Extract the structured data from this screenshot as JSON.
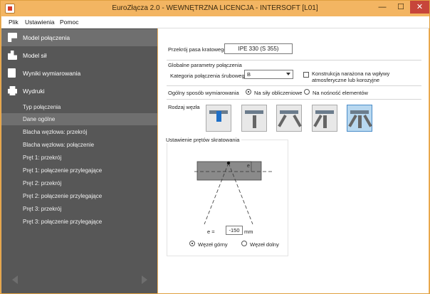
{
  "window": {
    "title": "EuroZłącza 2.0 - WEWNĘTRZNA LICENCJA - INTERSOFT [L01]",
    "min": "—",
    "max": "☐",
    "close": "✕"
  },
  "menu": [
    "Plik",
    "Ustawienia",
    "Pomoc"
  ],
  "sidebar": {
    "top_items": [
      {
        "label": "Model połączenia",
        "icon": "flag-icon",
        "active": true
      },
      {
        "label": "Model sił",
        "icon": "beam-icon",
        "active": false
      },
      {
        "label": "Wyniki wymiarowania",
        "icon": "results-icon",
        "active": false
      },
      {
        "label": "Wydruki",
        "icon": "printer-icon",
        "active": false
      }
    ],
    "sub_items": [
      {
        "label": "Typ połączenia",
        "active": false
      },
      {
        "label": "Dane ogólne",
        "active": true
      },
      {
        "label": "Blacha węzłowa: przekrój",
        "active": false
      },
      {
        "label": "Blacha węzłowa: połączenie",
        "active": false
      },
      {
        "label": "Pręt 1: przekrój",
        "active": false
      },
      {
        "label": "Pręt 1: połączenie przylegające",
        "active": false
      },
      {
        "label": "Pręt 2: przekrój",
        "active": false
      },
      {
        "label": "Pręt 2: połączenie przylegające",
        "active": false
      },
      {
        "label": "Pręt 3: przekrój",
        "active": false
      },
      {
        "label": "Pręt 3: połączenie przylegające",
        "active": false
      }
    ]
  },
  "main": {
    "section_label": "Przekrój pasa kratowego:",
    "section_value": "IPE 330 (S 355)",
    "global_params_title": "Globalne parametry połączenia",
    "bolt_category_label": "Kategoria połączenia śrubowego",
    "bolt_category_value": "B",
    "corrosion_label": "Konstrukcja narażona na wpływy atmosferyczne lub korozyjne",
    "design_method_label": "Ogólny sposób wymiarowania",
    "method_option_1": "Na siły obliczeniowe",
    "method_option_2": "Na nośność elementów",
    "node_type_label": "Rodzaj węzła",
    "node_types": [
      "node-type-1",
      "node-type-2",
      "node-type-3",
      "node-type-4",
      "node-type-5"
    ],
    "selected_node": 4,
    "bracing_title": "Ustawienie prętów skratowania",
    "dim_label": "e",
    "e_label": "e =",
    "e_value": "-150",
    "e_unit": "mm",
    "node_top": "Węzeł górny",
    "node_bottom": "Węzeł dolny"
  }
}
